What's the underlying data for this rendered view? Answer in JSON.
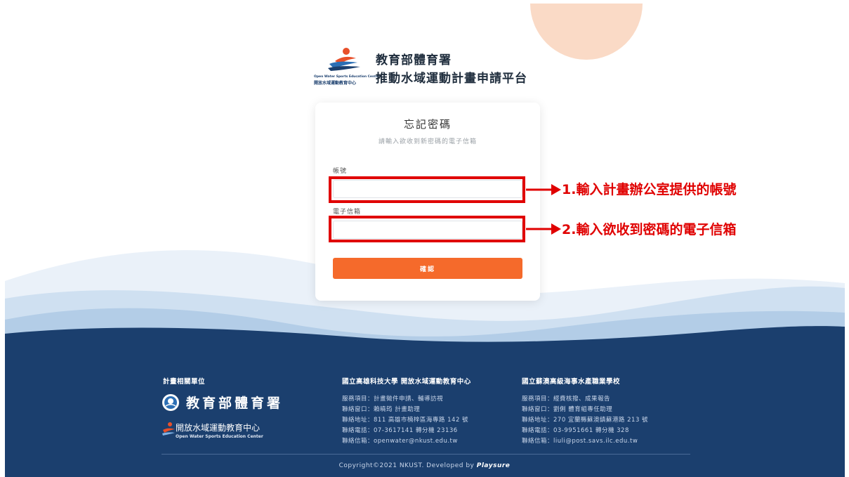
{
  "header": {
    "logo_en": "Open Water Sports Education Center",
    "logo_zh": "開放水域運動教育中心",
    "title_line1": "教育部體育署",
    "title_line2": "推動水域運動計畫申請平台"
  },
  "form": {
    "title": "忘記密碼",
    "subtitle": "請輸入欲收到新密碼的電子信箱",
    "account_label": "帳號",
    "account_value": "",
    "email_label": "電子信箱",
    "email_value": "",
    "submit_label": "確認"
  },
  "annotations": {
    "note1": "1.輸入計畫辦公室提供的帳號",
    "note2": "2.輸入欲收到密碼的電子信箱",
    "color": "#e00000"
  },
  "footer": {
    "related_title": "計畫相關單位",
    "sports_admin_name": "教育部體育署",
    "center_name": "開放水域運動教育中心",
    "center_name_en": "Open Water Sports Education Center",
    "nkust": {
      "title": "國立高雄科技大學 開放水域運動教育中心",
      "lines": [
        "服務項目：計畫徵件申請、輔導訪視",
        "聯絡窗口：賴曉筠 計畫助理",
        "聯絡地址：811 高雄市楠梓區海專路 142 號",
        "聯絡電話：07-3617141 轉分機 23136",
        "聯絡信箱：openwater@nkust.edu.tw"
      ]
    },
    "savs": {
      "title": "國立蘇澳高級海事水產職業學校",
      "lines": [
        "服務項目：經費核撥、成果報告",
        "聯絡窗口：劉俐 體育組專任助理",
        "聯絡地址：270 宜蘭縣蘇澳鎮蘇港路 213 號",
        "聯絡電話：03-9951661 轉分機 328",
        "聯絡信箱：liuli@post.savs.ilc.edu.tw"
      ]
    },
    "copyright": "Copyright©2021 NKUST. Developed by",
    "developer": "Playsure"
  },
  "colors": {
    "accent_orange": "#f56a2b",
    "footer_navy": "#1b3f6e",
    "highlight_red": "#e00000"
  }
}
